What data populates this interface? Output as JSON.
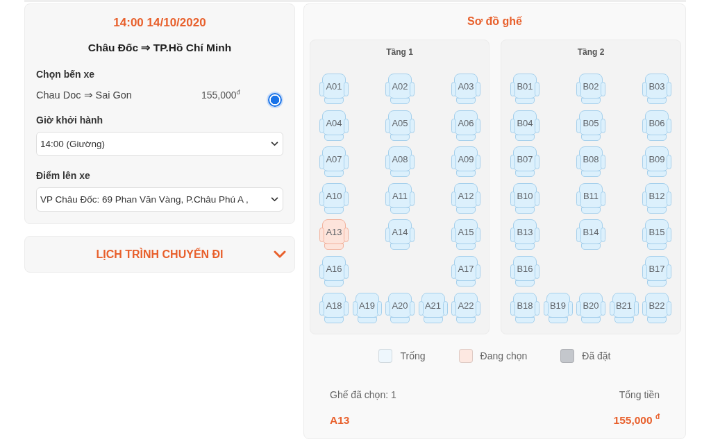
{
  "trip": {
    "time": "14:00 14/10/2020",
    "route": "Châu Đốc ⇒ TP.Hồ Chí Minh",
    "station_label": "Chọn bến xe",
    "station_options": [
      {
        "name": "Chau Doc ⇒ Sai Gon",
        "price": "155,000$^{đ}$",
        "selected": true
      }
    ],
    "departure_label": "Giờ khởi hành",
    "departure_value": "14:00 (Giường)",
    "pickup_label": "Điểm lên xe",
    "pickup_value": "VP Châu Đốc: 69 Phan Văn Vàng, P.Châu Phú A ,"
  },
  "itinerary": {
    "title": "LỊCH TRÌNH CHUYẾN ĐI",
    "expanded": false
  },
  "seat_map": {
    "title": "Sơ đồ ghế",
    "decks": [
      {
        "title": "Tầng 1",
        "rows": [
          [
            {
              "label": "A01",
              "selected": false
            },
            "",
            {
              "label": "A02",
              "selected": false
            },
            "",
            {
              "label": "A03",
              "selected": false
            }
          ],
          [
            {
              "label": "A04",
              "selected": false
            },
            "",
            {
              "label": "A05",
              "selected": false
            },
            "",
            {
              "label": "A06",
              "selected": false
            }
          ],
          [
            {
              "label": "A07",
              "selected": false
            },
            "",
            {
              "label": "A08",
              "selected": false
            },
            "",
            {
              "label": "A09",
              "selected": false
            }
          ],
          [
            {
              "label": "A10",
              "selected": false
            },
            "",
            {
              "label": "A11",
              "selected": false
            },
            "",
            {
              "label": "A12",
              "selected": false
            }
          ],
          [
            {
              "label": "A13",
              "selected": true
            },
            "",
            {
              "label": "A14",
              "selected": false
            },
            "",
            {
              "label": "A15",
              "selected": false
            }
          ],
          [
            {
              "label": "A16",
              "selected": false
            },
            "",
            "",
            "",
            {
              "label": "A17",
              "selected": false
            }
          ],
          [
            {
              "label": "A18",
              "selected": false
            },
            {
              "label": "A19",
              "selected": false
            },
            {
              "label": "A20",
              "selected": false
            },
            {
              "label": "A21",
              "selected": false
            },
            {
              "label": "A22",
              "selected": false
            }
          ]
        ]
      },
      {
        "title": "Tầng 2",
        "rows": [
          [
            {
              "label": "B01",
              "selected": false
            },
            "",
            {
              "label": "B02",
              "selected": false
            },
            "",
            {
              "label": "B03",
              "selected": false
            }
          ],
          [
            {
              "label": "B04",
              "selected": false
            },
            "",
            {
              "label": "B05",
              "selected": false
            },
            "",
            {
              "label": "B06",
              "selected": false
            }
          ],
          [
            {
              "label": "B07",
              "selected": false
            },
            "",
            {
              "label": "B08",
              "selected": false
            },
            "",
            {
              "label": "B09",
              "selected": false
            }
          ],
          [
            {
              "label": "B10",
              "selected": false
            },
            "",
            {
              "label": "B11",
              "selected": false
            },
            "",
            {
              "label": "B12",
              "selected": false
            }
          ],
          [
            {
              "label": "B13",
              "selected": false
            },
            "",
            {
              "label": "B14",
              "selected": false
            },
            "",
            {
              "label": "B15",
              "selected": false
            }
          ],
          [
            {
              "label": "B16",
              "selected": false
            },
            "",
            "",
            "",
            {
              "label": "B17",
              "selected": false
            }
          ],
          [
            {
              "label": "B18",
              "selected": false
            },
            {
              "label": "B19",
              "selected": false
            },
            {
              "label": "B20",
              "selected": false
            },
            {
              "label": "B21",
              "selected": false
            },
            {
              "label": "B22",
              "selected": false
            }
          ]
        ]
      }
    ],
    "legend": [
      {
        "label": "Trống",
        "color": "#eef7fd"
      },
      {
        "label": "Đang chọn",
        "color": "#fde8e1"
      },
      {
        "label": "Đã đặt",
        "color": "#c4c7cc"
      }
    ],
    "summary": {
      "count_label": "Ghế đã chọn: 1",
      "total_label": "Tổng tiền",
      "selected_seats": "A13",
      "total": "155,000 $^{đ}$"
    }
  }
}
